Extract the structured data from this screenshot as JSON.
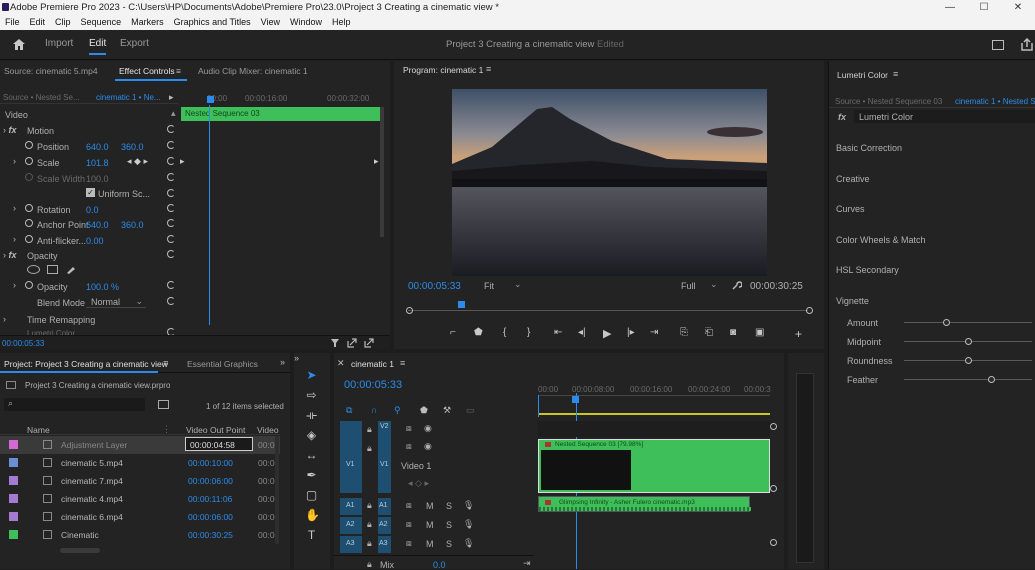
{
  "window": {
    "title": "Adobe Premiere Pro 2023 - C:\\Users\\HP\\Documents\\Adobe\\Premiere Pro\\23.0\\Project 3 Creating a cinematic view *",
    "controls": [
      "—",
      "☐",
      "✕"
    ]
  },
  "menu": [
    "File",
    "Edit",
    "Clip",
    "Sequence",
    "Markers",
    "Graphics and Titles",
    "View",
    "Window",
    "Help"
  ],
  "header": {
    "tabs": [
      "Import",
      "Edit",
      "Export"
    ],
    "project_title": "Project 3 Creating a cinematic view",
    "status": "Edited"
  },
  "effect_controls": {
    "tabs": [
      "Source: cinematic 5.mp4",
      "Effect Controls",
      "Audio Clip Mixer: cinematic 1"
    ],
    "source_label": "Source • Nested Se...",
    "sequence_label": "cinematic 1 • Ne...",
    "ruler": [
      "00:00",
      "00:00:16:00",
      "00:00:32:00"
    ],
    "clip_label": "Nested Sequence 03",
    "section_video": "Video",
    "motion": "Motion",
    "position_label": "Position",
    "position_x": "640.0",
    "position_y": "360.0",
    "scale_label": "Scale",
    "scale_val": "101.8",
    "scale_width_label": "Scale Width",
    "scale_width_val": "100.0",
    "uniform_label": "Uniform Sc...",
    "rotation_label": "Rotation",
    "rotation_val": "0.0",
    "anchor_label": "Anchor Point",
    "anchor_x": "640.0",
    "anchor_y": "360.0",
    "antiflicker_label": "Anti-flicker...",
    "antiflicker_val": "0.00",
    "opacity_section": "Opacity",
    "opacity_label": "Opacity",
    "opacity_val": "100.0 %",
    "blend_label": "Blend Mode",
    "blend_val": "Normal",
    "time_remap": "Time Remapping",
    "lumetri_partial": "Lumetri Color",
    "timecode": "00:00:05:33"
  },
  "program": {
    "title": "Program: cinematic 1",
    "timecode": "00:00:05:33",
    "fit": "Fit",
    "quality": "Full",
    "duration": "00:00:30:25"
  },
  "lumetri": {
    "title": "Lumetri Color",
    "source_label": "Source • Nested Sequence 03",
    "sequence_label": "cinematic 1 • Nested Se",
    "fx_label": "Lumetri Color",
    "sections": [
      "Basic Correction",
      "Creative",
      "Curves",
      "Color Wheels & Match",
      "HSL Secondary",
      "Vignette"
    ],
    "vignette": [
      {
        "label": "Amount",
        "value": 0.33
      },
      {
        "label": "Midpoint",
        "value": 0.5
      },
      {
        "label": "Roundness",
        "value": 0.5
      },
      {
        "label": "Feather",
        "value": 0.68
      }
    ]
  },
  "project": {
    "tabs": [
      "Project: Project 3 Creating a cinematic view",
      "Essential Graphics"
    ],
    "file": "Project 3 Creating a cinematic view.prproj",
    "selection": "1 of 12 items selected",
    "col_name": "Name",
    "col_out": "Video Out Point",
    "col_vid": "Video I",
    "items": [
      {
        "name": "Adjustment Layer",
        "out": "00:00:04:58",
        "vid": "00:0",
        "color": "#d26ad2"
      },
      {
        "name": "cinematic 5.mp4",
        "out": "00:00:10:00",
        "vid": "00:0",
        "color": "#6a8fd2"
      },
      {
        "name": "cinematic 7.mp4",
        "out": "00:00:06:00",
        "vid": "00:0",
        "color": "#a57ad2"
      },
      {
        "name": "cinematic 4.mp4",
        "out": "00:00:11:06",
        "vid": "00:0",
        "color": "#a57ad2"
      },
      {
        "name": "cinematic 6.mp4",
        "out": "00:00:06:00",
        "vid": "00:0",
        "color": "#a57ad2"
      },
      {
        "name": "Cinematic",
        "out": "00:00:30:25",
        "vid": "00:0",
        "color": "#3ebf5a"
      }
    ]
  },
  "timeline": {
    "tab": "cinematic 1",
    "timecode": "00:00:05:33",
    "ruler": [
      "00:00",
      "00:00:08:00",
      "00:00:16:00",
      "00:00:24:00",
      "00:00:3"
    ],
    "tracks": [
      {
        "id": "V2",
        "src": ""
      },
      {
        "id": "V1",
        "src": "V1",
        "name": "Video 1"
      },
      {
        "id": "A1",
        "src": "A1"
      },
      {
        "id": "A2",
        "src": "A2"
      },
      {
        "id": "A3",
        "src": "A3"
      }
    ],
    "mute": "M",
    "solo": "S",
    "video_clip": "Nested Sequence 03 [79.98%]",
    "audio_clip": "Glimpsing Infinity - Asher Fulero cinematic.mp3",
    "mix_label": "Mix",
    "mix_val": "0.0"
  },
  "colors": {
    "accent": "#2d8ceb",
    "clip_green": "#3ebf5a",
    "track_blue": "#1e4e70"
  }
}
